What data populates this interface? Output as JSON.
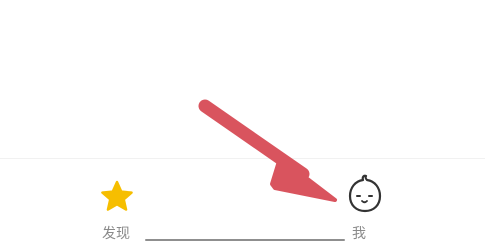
{
  "tabbar": {
    "tabs": [
      {
        "label": "发现",
        "icon": "star-icon",
        "active": false
      },
      {
        "label": "我",
        "icon": "face-icon",
        "active": false
      }
    ]
  },
  "annotation": {
    "icon": "arrow-icon",
    "color": "#d9545e"
  },
  "colors": {
    "star": "#f6be00",
    "tab_label": "#8a8a8a",
    "background": "#ffffff"
  }
}
